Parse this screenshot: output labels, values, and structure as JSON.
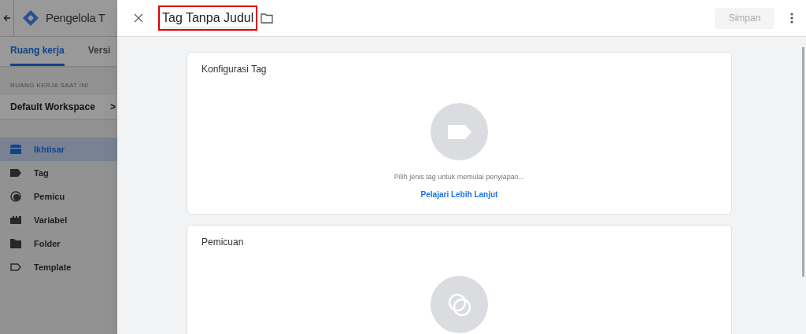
{
  "app": {
    "title": "Pengelola T",
    "tabs": [
      {
        "label": "Ruang kerja",
        "selected": true
      },
      {
        "label": "Versi",
        "selected": false
      }
    ],
    "workspace": {
      "heading": "RUANG KERJA SAAT INI",
      "name": "Default Workspace",
      "chevron": ">"
    },
    "nav": [
      {
        "label": "Ikhtisar",
        "selected": true
      },
      {
        "label": "Tag",
        "selected": false
      },
      {
        "label": "Pemicu",
        "selected": false
      },
      {
        "label": "Variabel",
        "selected": false
      },
      {
        "label": "Folder",
        "selected": false
      },
      {
        "label": "Template",
        "selected": false
      }
    ]
  },
  "editor": {
    "title": {
      "value": "Tag Tanpa Judul",
      "highlighted": true
    },
    "save_button": {
      "label": "Simpan",
      "disabled": true
    },
    "cards": [
      {
        "kind": "tag",
        "title": "Konfigurasi Tag",
        "hint": "Pilih jenis tag untuk memulai penyiapan...",
        "link": "Pelajari Lebih Lanjut"
      },
      {
        "kind": "trigger",
        "title": "Pemicuan"
      }
    ]
  }
}
